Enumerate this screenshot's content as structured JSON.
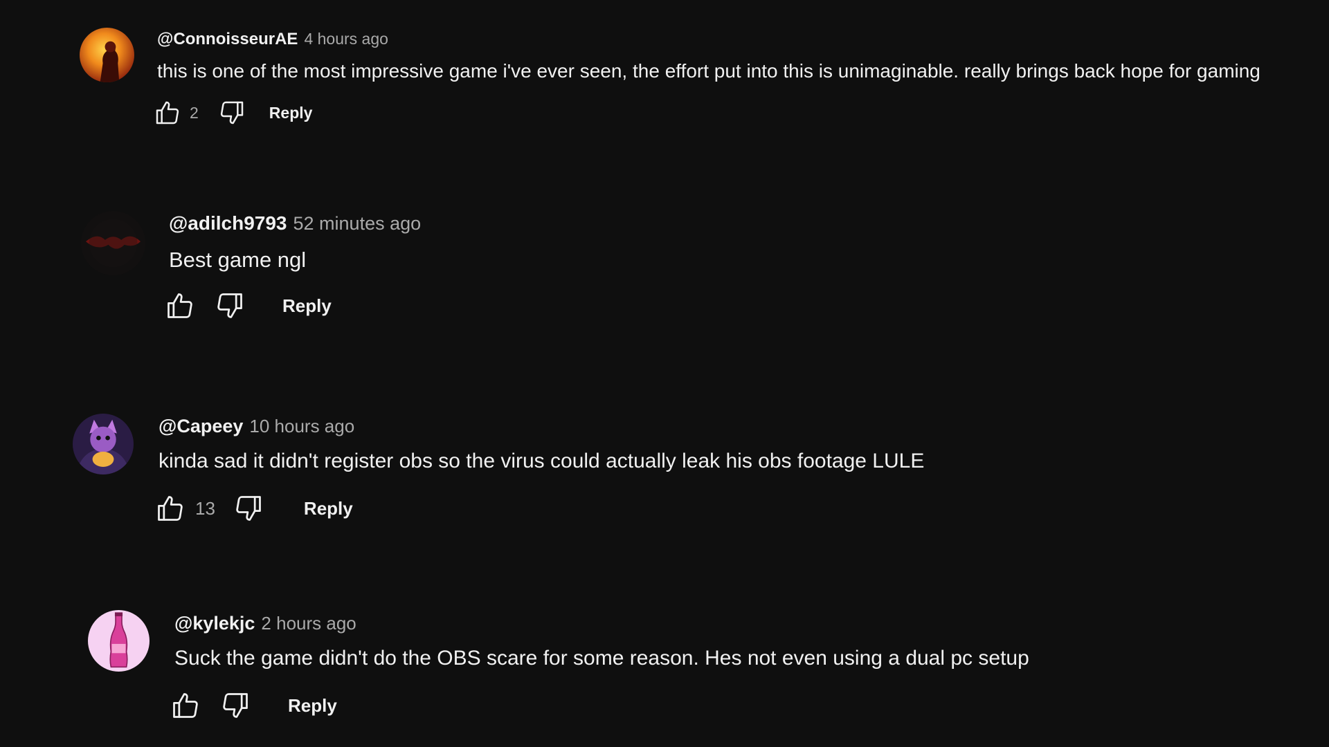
{
  "comments": [
    {
      "author": "@ConnoisseurAE",
      "time": "4 hours ago",
      "text": "this is one of the most impressive game i've ever seen, the effort put into this is unimaginable. really brings back hope for gaming",
      "likes": "2",
      "reply_label": "Reply",
      "avatar": "fiery-figure-avatar"
    },
    {
      "author": "@adilch9793",
      "time": "52 minutes ago",
      "text": "Best game ngl",
      "likes": "",
      "reply_label": "Reply",
      "avatar": "dark-red-avatar"
    },
    {
      "author": "@Capeey",
      "time": "10 hours ago",
      "text": "kinda sad it didn't register obs so the virus could actually leak his obs footage LULE",
      "likes": "13",
      "reply_label": "Reply",
      "avatar": "cartoon-cat-avatar"
    },
    {
      "author": "@kylekjc",
      "time": "2 hours ago",
      "text": "Suck the game didn't do the OBS scare for some reason. Hes not even using a dual pc setup",
      "likes": "",
      "reply_label": "Reply",
      "avatar": "soda-bottle-avatar"
    }
  ],
  "icons": {
    "like": "thumbs-up-icon",
    "dislike": "thumbs-down-icon"
  },
  "colors": {
    "background": "#0f0f0f",
    "primary_text": "#f1f1f1",
    "secondary_text": "#aaaaaa"
  }
}
